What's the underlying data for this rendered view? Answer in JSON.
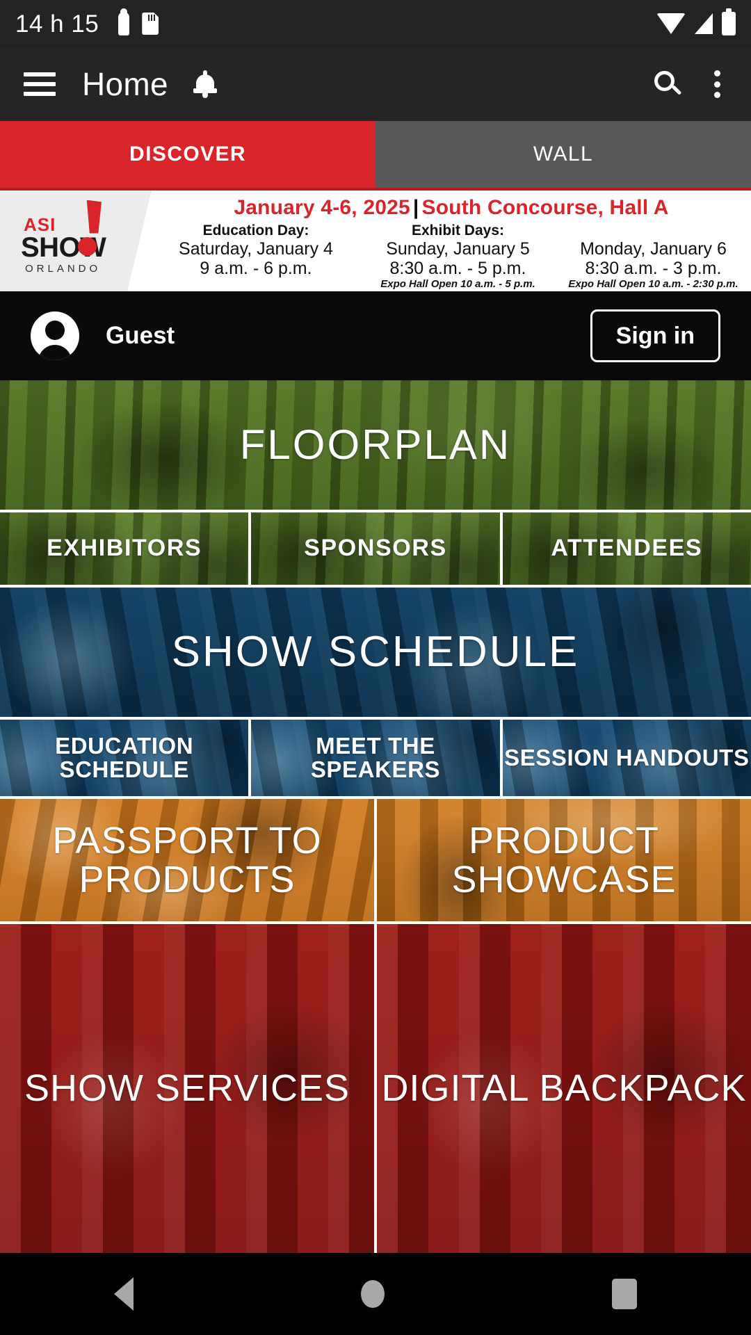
{
  "status_bar": {
    "time": "14 h 15",
    "left_icons": [
      "usb-icon",
      "sd-card-icon"
    ],
    "right_icons": [
      "wifi-icon",
      "cellular-signal-icon",
      "battery-icon"
    ]
  },
  "app_bar": {
    "menu_icon": "hamburger-menu-icon",
    "title": "Home",
    "bell_icon": "notification-bell-icon",
    "search_icon": "search-icon",
    "overflow_icon": "overflow-menu-icon"
  },
  "tabs": [
    {
      "label": "DISCOVER",
      "active": true,
      "color": "#d9252a"
    },
    {
      "label": "WALL",
      "active": false,
      "color": "#585858"
    }
  ],
  "banner": {
    "logo": {
      "asi": "ASI",
      "show": "SHOW",
      "city": "ORLANDO"
    },
    "headline_date": "January 4-6, 2025",
    "headline_sep": "|",
    "headline_venue": "South Concourse, Hall A",
    "columns": [
      {
        "title": "Education Day:",
        "day": "Saturday, January 4",
        "hours": "9 a.m. - 6 p.m.",
        "note": ""
      },
      {
        "title": "Exhibit Days:",
        "day": "Sunday, January 5",
        "hours": "8:30 a.m. - 5 p.m.",
        "note": "Expo Hall Open 10 a.m. - 5 p.m."
      },
      {
        "title": "",
        "day": "Monday, January 6",
        "hours": "8:30 a.m. - 3 p.m.",
        "note": "Expo Hall Open 10 a.m. - 2:30 p.m."
      }
    ],
    "exhibit_title": "Exhibit Days:"
  },
  "account": {
    "avatar_icon": "user-avatar-icon",
    "name": "Guest",
    "sign_in_label": "Sign in"
  },
  "tiles": {
    "floorplan": "FLOORPLAN",
    "exhibitors": "EXHIBITORS",
    "sponsors": "SPONSORS",
    "attendees": "ATTENDEES",
    "show_schedule": "SHOW SCHEDULE",
    "education_schedule": "EDUCATION SCHEDULE",
    "meet_the_speakers": "MEET THE SPEAKERS",
    "session_handouts": "SESSION HANDOUTS",
    "passport_to_products": "PASSPORT TO PRODUCTS",
    "product_showcase": "PRODUCT SHOWCASE",
    "show_services": "SHOW SERVICES",
    "digital_backpack": "DIGITAL BACKPACK"
  },
  "nav_bar": {
    "back_icon": "back-triangle-icon",
    "home_icon": "home-circle-icon",
    "recents_icon": "recents-square-icon"
  },
  "colors": {
    "accent_red": "#d9252a",
    "tab_inactive": "#585858",
    "app_bar": "#252525",
    "green": "#688c30",
    "blue": "#1b5f86",
    "orange": "#dd9730",
    "red": "#b0241c"
  }
}
